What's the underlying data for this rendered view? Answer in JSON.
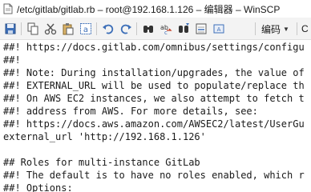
{
  "window": {
    "title": "/etc/gitlab/gitlab.rb – root@192.168.1.126 – 编辑器 – WinSCP"
  },
  "toolbar": {
    "encoding_label": "编码",
    "extra_label": "C",
    "icons": [
      "save-icon",
      "copy-icon",
      "cut-icon",
      "paste-icon",
      "select-all-icon",
      "undo-icon",
      "redo-icon",
      "find-icon",
      "replace-icon",
      "find-next-icon",
      "goto-line-icon",
      "encoding-icon"
    ]
  },
  "editor": {
    "lines": [
      "##! https://docs.gitlab.com/omnibus/settings/configu",
      "##!",
      "##! Note: During installation/upgrades, the value of",
      "##! EXTERNAL_URL will be used to populate/replace th",
      "##! On AWS EC2 instances, we also attempt to fetch t",
      "##! address from AWS. For more details, see:",
      "##! https://docs.aws.amazon.com/AWSEC2/latest/UserGu",
      "external_url 'http://192.168.1.126'",
      "",
      "## Roles for multi-instance GitLab",
      "##! The default is to have no roles enabled, which r",
      "##! Options:"
    ]
  }
}
